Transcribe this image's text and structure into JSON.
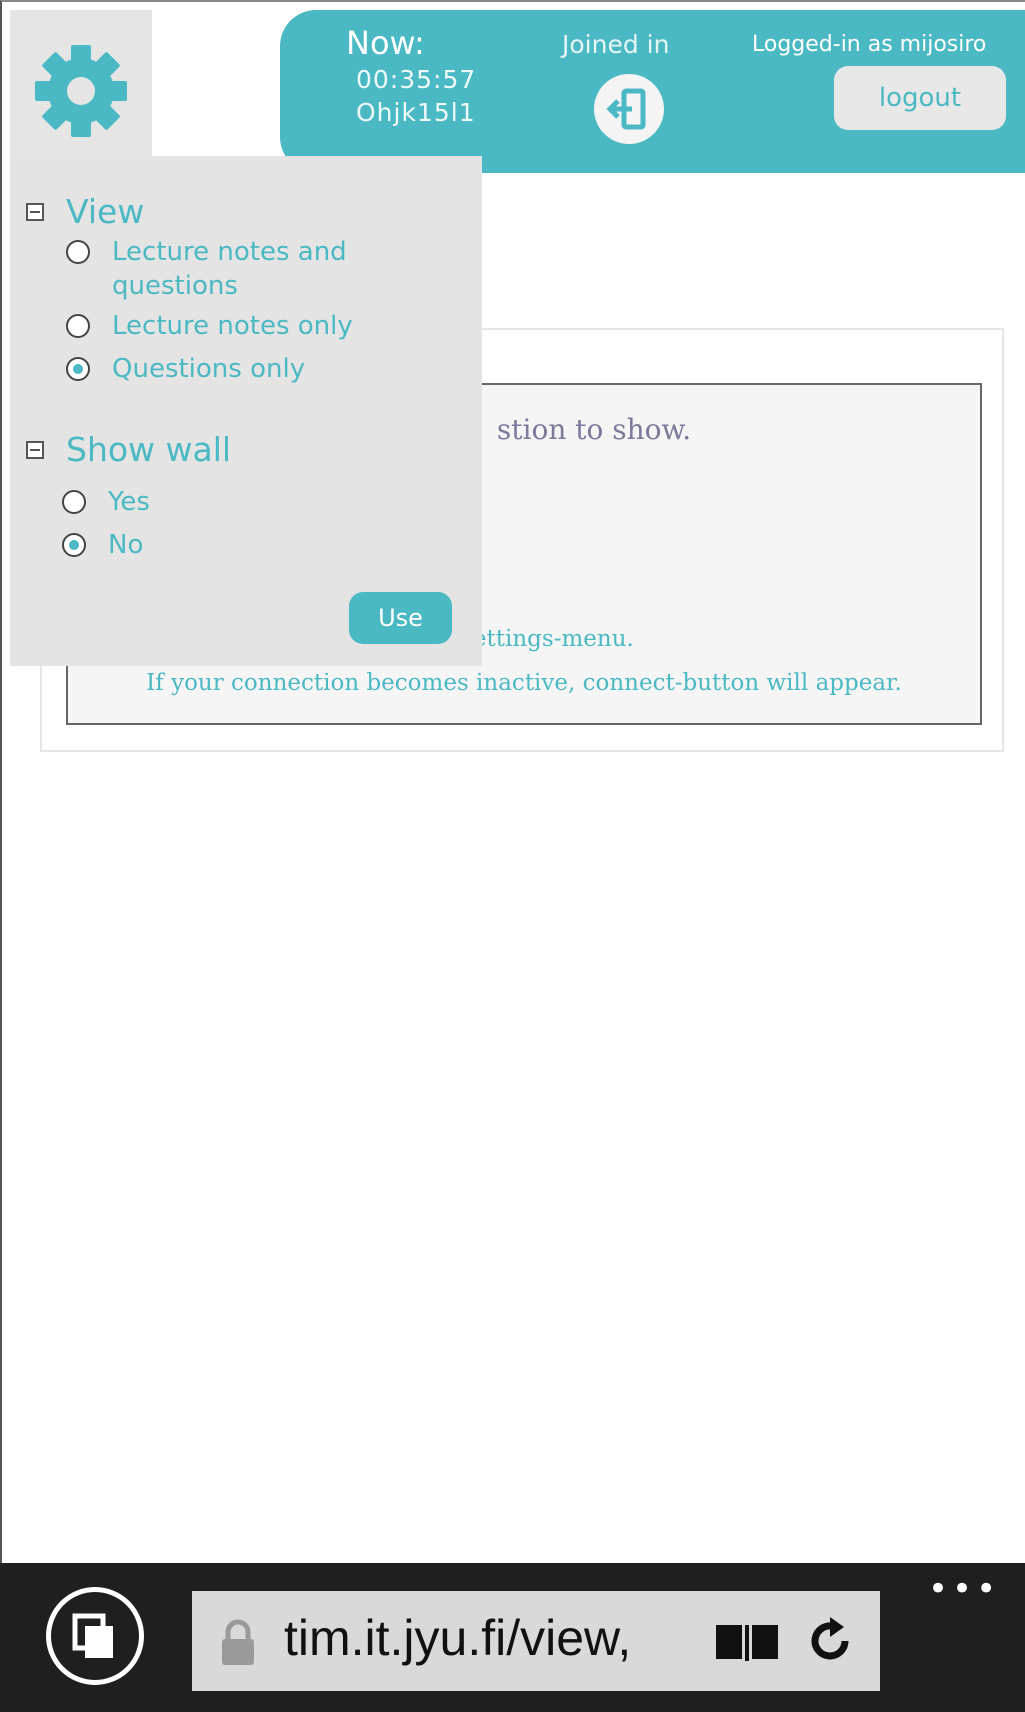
{
  "header": {
    "now_label": "Now:",
    "time": "00:35:57",
    "code": "Ohjk15l1",
    "joined_label": "Joined in",
    "logged_in": "Logged-in as mijosiro",
    "logout_label": "logout"
  },
  "settings": {
    "view_title": "View",
    "view_options": [
      {
        "label": "Lecture notes and questions",
        "checked": false
      },
      {
        "label": "Lecture notes only",
        "checked": false
      },
      {
        "label": "Questions only",
        "checked": true
      }
    ],
    "wall_title": "Show wall",
    "wall_options": [
      {
        "label": "Yes",
        "checked": false
      },
      {
        "label": "No",
        "checked": true
      }
    ],
    "use_label": "Use"
  },
  "content": {
    "message_visible": "stion to show.",
    "settings_visible": "om Settings-menu.",
    "connection_hint": "If your connection becomes inactive, connect-button will appear."
  },
  "browser": {
    "url": "tim.it.jyu.fi/view,",
    "more": "•••"
  },
  "colors": {
    "accent": "#4bb9c3",
    "panel": "#e4e4e4",
    "browser_bar": "#1f1f1f"
  }
}
